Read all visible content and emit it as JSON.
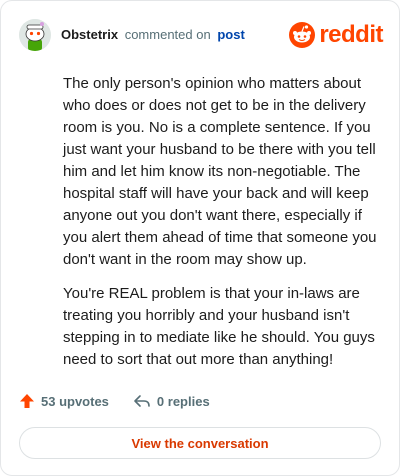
{
  "header": {
    "username": "Obstetrix",
    "action_text": "commented on",
    "target_link": "post",
    "brand": "reddit"
  },
  "comment": {
    "paragraphs": [
      "The only person's opinion who matters about who does or does not get to be in the delivery room is you. No is a complete sentence. If you just want your husband to be there with you tell him and let him know its non-negotiable. The hospital staff will have your back and will keep anyone out you don't want there, especially if you alert them ahead of time that someone you don't want in the room may show up.",
      "You're REAL problem is that your in-laws are treating you horribly and your husband isn't stepping in to mediate like he should. You guys need to sort that out more than anything!"
    ]
  },
  "actions": {
    "upvotes": "53 upvotes",
    "replies": "0 replies"
  },
  "cta": {
    "label": "View the conversation"
  },
  "colors": {
    "brand": "#ff4500",
    "link": "#0045ac",
    "cta_text": "#d93900",
    "muted": "#576f76"
  },
  "icons": [
    "reddit-snoo-avatar-icon",
    "reddit-logo-icon",
    "upvote-arrow-icon",
    "reply-arrow-icon"
  ]
}
